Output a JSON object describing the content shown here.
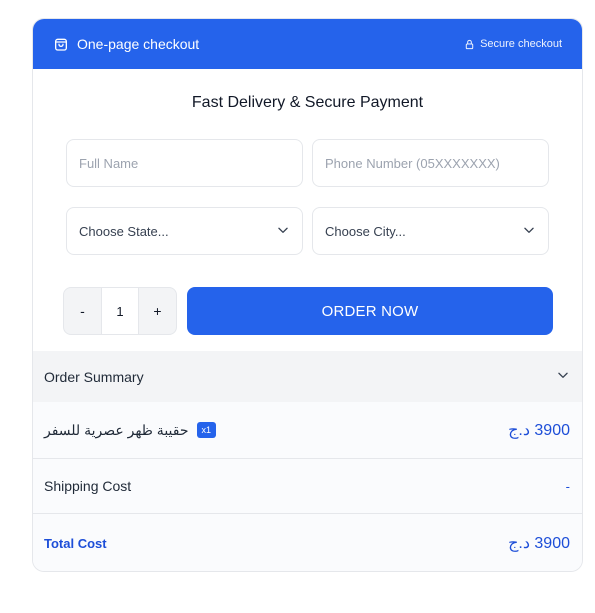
{
  "header": {
    "title": "One-page checkout",
    "secure_label": "Secure checkout",
    "bag_icon": "shopping-bag-icon",
    "lock_icon": "lock-icon",
    "color": "#2563eb"
  },
  "form": {
    "title": "Fast Delivery & Secure Payment",
    "full_name_placeholder": "Full Name",
    "phone_placeholder": "Phone Number (05XXXXXXX)",
    "state_select": "Choose State...",
    "city_select": "Choose City..."
  },
  "quantity": {
    "minus_label": "-",
    "value": "1",
    "plus_label": "+"
  },
  "order_button_label": "ORDER NOW",
  "summary": {
    "title": "Order Summary",
    "product": {
      "name": "حقيبة ظهر عصرية للسفر",
      "qty_badge": "x1",
      "price": "3900 د.ج"
    },
    "shipping": {
      "label": "Shipping Cost",
      "value": "-"
    },
    "total": {
      "label": "Total Cost",
      "value": "3900 د.ج"
    }
  },
  "colors": {
    "accent": "#2563eb",
    "price": "#1d4ed8",
    "summary_bg": "#f3f4f6"
  }
}
